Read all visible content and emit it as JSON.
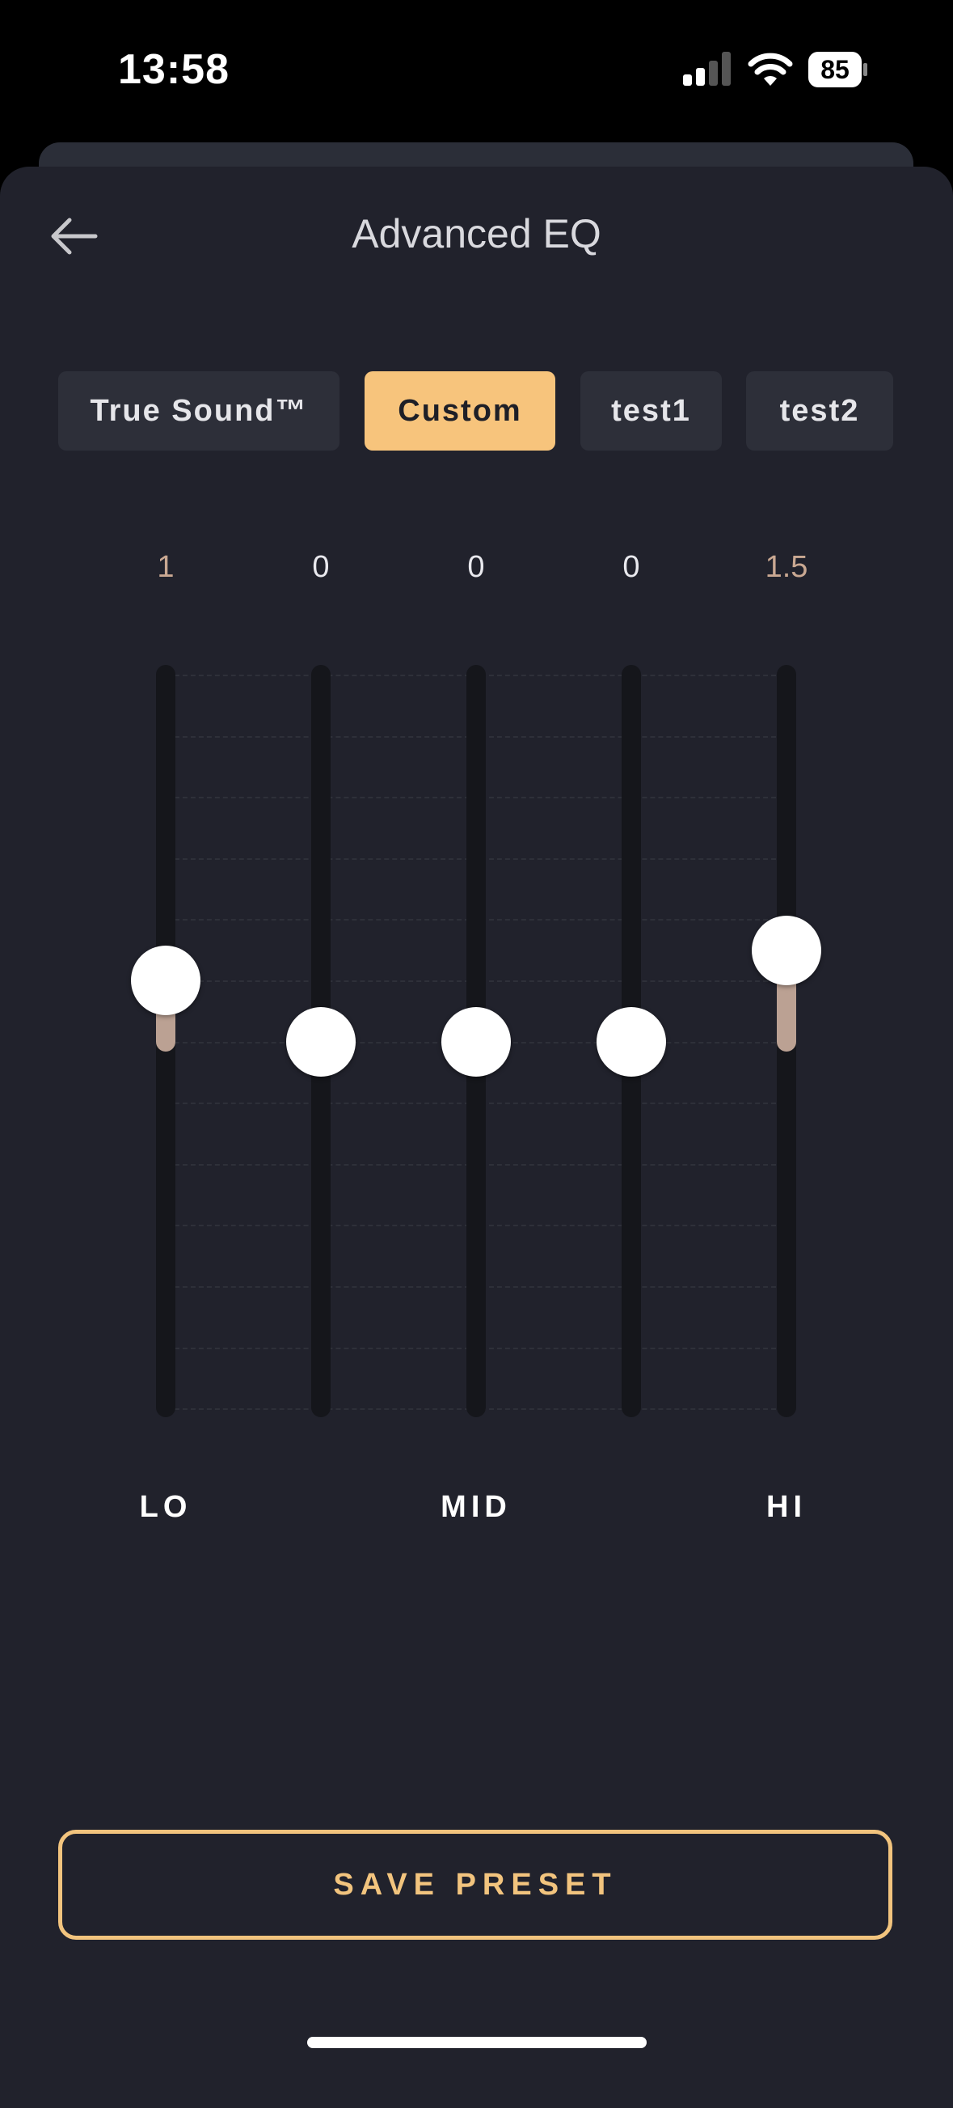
{
  "status_bar": {
    "time": "13:58",
    "battery": "85"
  },
  "header": {
    "title": "Advanced EQ",
    "back_icon": "arrow-left-icon"
  },
  "presets": [
    {
      "label": "True Sound™",
      "active": false
    },
    {
      "label": "Custom",
      "active": true
    },
    {
      "label": "test1",
      "active": false
    },
    {
      "label": "test2",
      "active": false
    }
  ],
  "eq": {
    "range": [
      -6,
      6
    ],
    "bands": [
      {
        "value_text": "1",
        "value": 1
      },
      {
        "value_text": "0",
        "value": 0
      },
      {
        "value_text": "0",
        "value": 0
      },
      {
        "value_text": "0",
        "value": 0
      },
      {
        "value_text": "1.5",
        "value": 1.5
      }
    ],
    "band_labels": [
      "LO",
      "MID",
      "HI"
    ]
  },
  "save_button": {
    "label": "SAVE PRESET"
  },
  "colors": {
    "accent": "#f7c47c",
    "background": "#21222c",
    "slider_fill": "#bba193",
    "modified_value": "#c9a892"
  }
}
